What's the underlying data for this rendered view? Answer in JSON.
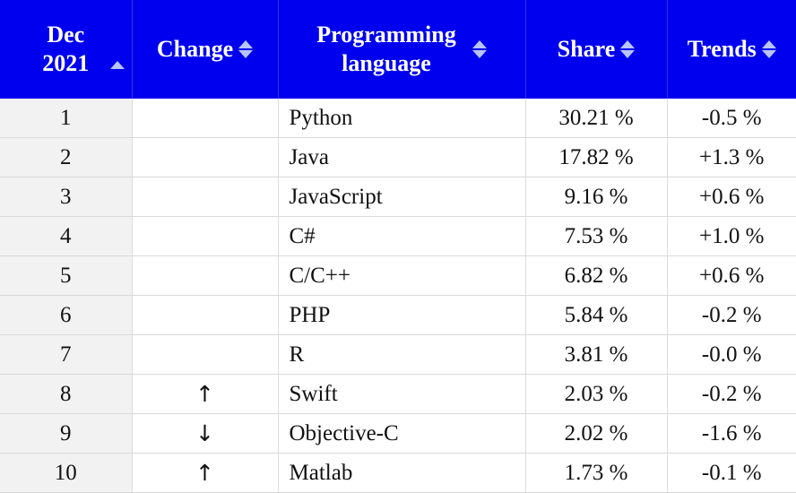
{
  "header": {
    "rank_line1": "Dec",
    "rank_line2": "2021",
    "change": "Change",
    "language_line1": "Programming",
    "language_line2": "language",
    "share": "Share",
    "trends": "Trends"
  },
  "colors": {
    "header_bg": "#0000ee",
    "header_text": "#ffffff",
    "sort_icon": "#b8c3ff",
    "rank_col_bg": "#f2f2f2"
  },
  "icons": {
    "sort": "sort-updown-icon",
    "sorted_asc": "sort-asc-icon",
    "up": "arrow-up-icon",
    "down": "arrow-down-icon"
  },
  "rows": [
    {
      "rank": "1",
      "change": "",
      "language": "Python",
      "share": "30.21 %",
      "trend": "-0.5 %"
    },
    {
      "rank": "2",
      "change": "",
      "language": "Java",
      "share": "17.82 %",
      "trend": "+1.3 %"
    },
    {
      "rank": "3",
      "change": "",
      "language": "JavaScript",
      "share": "9.16 %",
      "trend": "+0.6 %"
    },
    {
      "rank": "4",
      "change": "",
      "language": "C#",
      "share": "7.53 %",
      "trend": "+1.0 %"
    },
    {
      "rank": "5",
      "change": "",
      "language": "C/C++",
      "share": "6.82 %",
      "trend": "+0.6 %"
    },
    {
      "rank": "6",
      "change": "",
      "language": "PHP",
      "share": "5.84 %",
      "trend": "-0.2 %"
    },
    {
      "rank": "7",
      "change": "",
      "language": "R",
      "share": "3.81 %",
      "trend": "-0.0 %"
    },
    {
      "rank": "8",
      "change": "↑",
      "language": "Swift",
      "share": "2.03 %",
      "trend": "-0.2 %"
    },
    {
      "rank": "9",
      "change": "↓",
      "language": "Objective-C",
      "share": "2.02 %",
      "trend": "-1.6 %"
    },
    {
      "rank": "10",
      "change": "↑",
      "language": "Matlab",
      "share": "1.73 %",
      "trend": "-0.1 %"
    }
  ]
}
